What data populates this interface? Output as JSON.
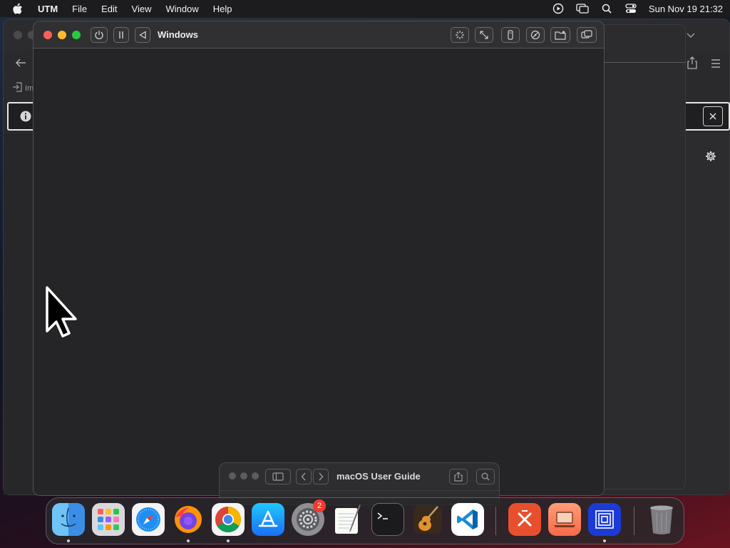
{
  "menubar": {
    "app_name": "UTM",
    "menus": [
      "File",
      "Edit",
      "View",
      "Window",
      "Help"
    ],
    "clock": "Sun Nov 19  21:32",
    "status_icons": [
      "play-circle-icon",
      "screen-mirroring-icon",
      "search-icon",
      "control-center-icon"
    ]
  },
  "vm_window": {
    "title": "Windows",
    "toolbar_left": [
      "power-icon",
      "pause-icon",
      "back-icon"
    ],
    "toolbar_right": [
      "display-icon",
      "resize-icon",
      "usb-icon",
      "drive-icon",
      "shared-folder-icon",
      "windows-icon"
    ]
  },
  "bg_window": {
    "toolbar_label_fragment": "Im"
  },
  "help_window": {
    "title": "macOS User Guide"
  },
  "dock": {
    "apps": [
      {
        "name": "Finder",
        "icon": "finder-icon",
        "running": true
      },
      {
        "name": "Launchpad",
        "icon": "launchpad-icon",
        "running": false
      },
      {
        "name": "Safari",
        "icon": "safari-icon",
        "running": false
      },
      {
        "name": "Firefox",
        "icon": "firefox-icon",
        "running": true
      },
      {
        "name": "Google Chrome",
        "icon": "chrome-icon",
        "running": true
      },
      {
        "name": "App Store",
        "icon": "app-store-icon",
        "running": false
      },
      {
        "name": "System Settings",
        "icon": "settings-icon",
        "running": false,
        "badge": "2"
      },
      {
        "name": "TextEdit",
        "icon": "textedit-icon",
        "running": false
      },
      {
        "name": "Terminal",
        "icon": "terminal-icon",
        "running": false
      },
      {
        "name": "GarageBand",
        "icon": "garageband-icon",
        "running": false
      },
      {
        "name": "Visual Studio Code",
        "icon": "vscode-icon",
        "running": false
      },
      {
        "name": "Remote Desktop",
        "icon": "remote-desktop-icon",
        "running": false
      },
      {
        "name": "UTM",
        "icon": "utm-laptop-icon",
        "running": false
      },
      {
        "name": "Screens",
        "icon": "screens-icon",
        "running": true
      },
      {
        "name": "Trash",
        "icon": "trash-icon",
        "running": false
      }
    ]
  },
  "colors": {
    "close": "#fe5f57",
    "minimize": "#febc2e",
    "maximize": "#28c840",
    "badge": "#f23b30"
  }
}
